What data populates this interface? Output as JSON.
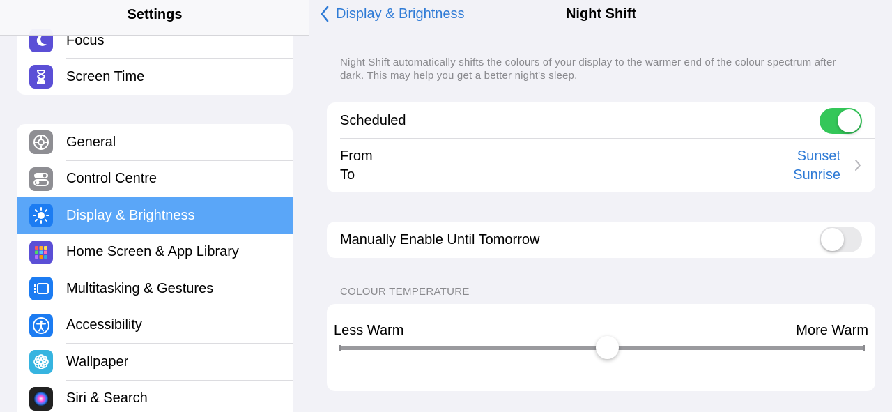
{
  "sidebar": {
    "title": "Settings",
    "group1": [
      {
        "label": "Focus",
        "icon": "moon-icon",
        "color": "#5b4fd6"
      },
      {
        "label": "Screen Time",
        "icon": "hourglass-icon",
        "color": "#5b4fd6"
      }
    ],
    "group2": [
      {
        "label": "General",
        "icon": "gear-icon",
        "color": "#8e8e93"
      },
      {
        "label": "Control Centre",
        "icon": "toggles-icon",
        "color": "#8e8e93"
      },
      {
        "label": "Display & Brightness",
        "icon": "sun-icon",
        "color": "#1c7cf2",
        "selected": true
      },
      {
        "label": "Home Screen & App Library",
        "icon": "app-grid-icon",
        "color": "#5b4fd6"
      },
      {
        "label": "Multitasking & Gestures",
        "icon": "multitasking-icon",
        "color": "#1c7cf2"
      },
      {
        "label": "Accessibility",
        "icon": "accessibility-icon",
        "color": "#1c7cf2"
      },
      {
        "label": "Wallpaper",
        "icon": "flower-icon",
        "color": "#36b4e0"
      },
      {
        "label": "Siri & Search",
        "icon": "siri-icon",
        "color": "#222222"
      }
    ]
  },
  "nav": {
    "back_label": "Display & Brightness",
    "title": "Night Shift"
  },
  "description": "Night Shift automatically shifts the colours of your display to the warmer end of the colour spectrum after dark. This may help you get a better night's sleep.",
  "scheduled": {
    "label": "Scheduled",
    "on": true
  },
  "schedule": {
    "from_label": "From",
    "to_label": "To",
    "from_value": "Sunset",
    "to_value": "Sunrise"
  },
  "manual": {
    "label": "Manually Enable Until Tomorrow",
    "on": false
  },
  "temperature": {
    "header": "COLOUR TEMPERATURE",
    "min_label": "Less Warm",
    "max_label": "More Warm",
    "value": 0.51
  },
  "colors": {
    "accent": "#2f7bd6",
    "selected_row": "#5aa6f8",
    "toggle_on": "#34c759"
  }
}
